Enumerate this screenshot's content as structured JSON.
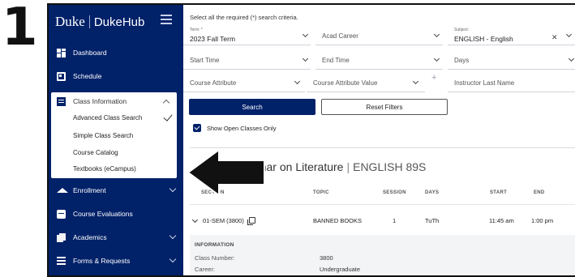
{
  "step_number": "1",
  "sidebar": {
    "brand_primary": "Duke",
    "brand_secondary": "DukeHub",
    "items": [
      {
        "label": "Dashboard",
        "icon": "dashboard-icon"
      },
      {
        "label": "Schedule",
        "icon": "calendar-icon"
      },
      {
        "label": "Enrollment",
        "icon": "graduation-cap-icon"
      },
      {
        "label": "Course Evaluations",
        "icon": "evaluation-icon"
      },
      {
        "label": "Academics",
        "icon": "academics-icon"
      },
      {
        "label": "Forms & Requests",
        "icon": "forms-icon"
      }
    ],
    "class_info": {
      "label": "Class Information",
      "subitems": [
        "Advanced Class Search",
        "Simple Class Search",
        "Course Catalog",
        "Textbooks (eCampus)"
      ],
      "selected": "Advanced Class Search"
    }
  },
  "search": {
    "note": "Select all the required (*) search criteria.",
    "term_label": "Term: *",
    "term_value": "2023 Fall Term",
    "acad_career": "Acad Career",
    "subject_label": "Subject:",
    "subject_value": "ENGLISH - English",
    "start_time": "Start Time",
    "end_time": "End Time",
    "days": "Days",
    "course_attribute": "Course Attribute",
    "course_attribute_value": "Course Attribute Value",
    "instructor_last_name": "Instructor Last Name",
    "search_button": "Search",
    "reset_button": "Reset Filters",
    "show_open_label": "Show Open Classes Only",
    "show_open_checked": true
  },
  "course": {
    "title": "-Year Seminar on Literature",
    "separator": "|",
    "code": "ENGLISH 89S",
    "columns": [
      "SECTION",
      "TOPIC",
      "SESSION",
      "DAYS",
      "START",
      "END"
    ],
    "row": {
      "section": "01-SEM (3800)",
      "topic": "BANNED BOOKS",
      "session": "1",
      "days": "TuTh",
      "start": "11:45 am",
      "end": "1:00 pm"
    },
    "info": {
      "heading": "INFORMATION",
      "class_number_label": "Class Number:",
      "class_number_value": "3800",
      "career_label": "Career:",
      "career_value": "Undergraduate"
    }
  },
  "colors": {
    "sidebar_bg": "#012169",
    "primary_button": "#012169",
    "arrow_fill": "#111111"
  }
}
